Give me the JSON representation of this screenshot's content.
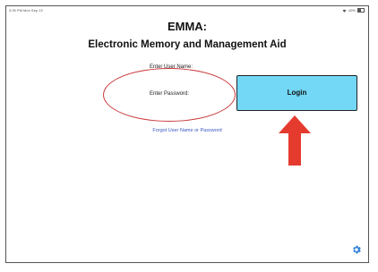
{
  "status_bar": {
    "time": "3:39 PM  Mon Sep 13",
    "battery": "49%"
  },
  "header": {
    "title": "EMMA:",
    "subtitle": "Electronic Memory and Management Aid"
  },
  "form": {
    "username_label": "Enter User Name:",
    "password_label": "Enter Password:",
    "login_label": "Login",
    "forgot_label": "Forgot User Name or Password"
  },
  "annotations": {
    "circle_color": "#c9393b",
    "arrow_color": "#e53a2e"
  },
  "colors": {
    "login_button": "#72d8f6",
    "link": "#3a57c4",
    "gear": "#2e7fd8"
  },
  "icons": {
    "settings": "gear-icon",
    "wifi": "wifi-icon",
    "battery": "battery-icon",
    "annotation": "arrow-up-icon"
  }
}
